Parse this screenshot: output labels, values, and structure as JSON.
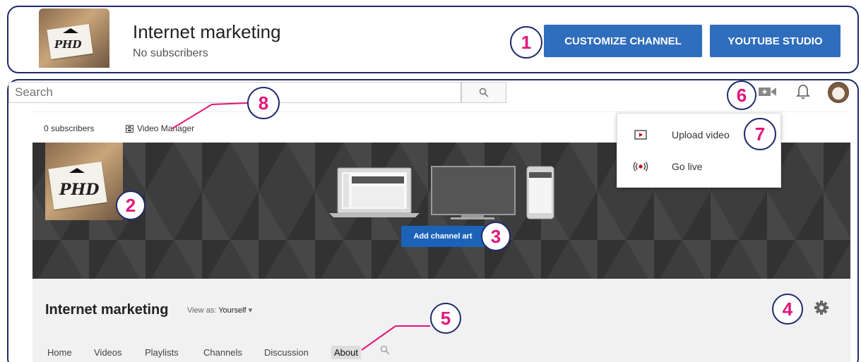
{
  "header": {
    "channel_name": "Internet marketing",
    "subscribers": "No subscribers",
    "customize_button": "CUSTOMIZE CHANNEL",
    "studio_button": "YOUTUBE STUDIO",
    "thumb_text": "PHD"
  },
  "search": {
    "placeholder": "Search"
  },
  "topbar": {
    "icons": [
      "search-icon",
      "video-camera-icon",
      "bell-icon",
      "avatar"
    ]
  },
  "menu": {
    "items": [
      {
        "label": "Upload video",
        "icon": "upload-video-icon"
      },
      {
        "label": "Go live",
        "icon": "live-broadcast-icon"
      }
    ]
  },
  "channel_page": {
    "subscribers": "0 subscribers",
    "video_manager": "Video Manager",
    "add_channel_art": "Add channel art",
    "channel_name": "Internet marketing",
    "view_as_label": "View as:",
    "view_as_value": "Yourself",
    "tabs": [
      "Home",
      "Videos",
      "Playlists",
      "Channels",
      "Discussion",
      "About"
    ],
    "active_tab": "About"
  },
  "callouts": [
    "1",
    "2",
    "3",
    "4",
    "5",
    "6",
    "7",
    "8"
  ],
  "colors": {
    "accent_button": "#2f6dbd",
    "callout_number": "#e3167a",
    "callout_border": "#1f2a6b",
    "leader_line": "#e3167a"
  }
}
